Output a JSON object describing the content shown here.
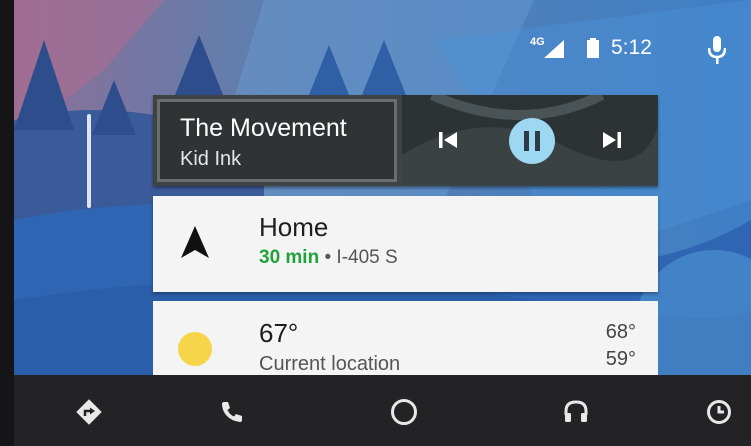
{
  "status": {
    "network": "4G",
    "time": "5:12"
  },
  "icons": {
    "signal": "signal-icon",
    "battery": "battery-icon",
    "mic": "mic-icon",
    "previous": "skip-previous-icon",
    "pause": "pause-icon",
    "next": "skip-next-icon",
    "navigation": "navigation-arrow-icon",
    "weather": "sun-icon",
    "nav_directions": "directions-icon",
    "phone": "phone-icon",
    "home": "home-circle-icon",
    "audio": "headphones-icon",
    "exit": "exit-icon"
  },
  "media": {
    "title": "The Movement",
    "artist": "Kid Ink"
  },
  "navigation": {
    "destination": "Home",
    "eta": "30 min",
    "route": " • I-405 S"
  },
  "weather": {
    "temperature": "67°",
    "location": "Current location",
    "high": "68°",
    "low": "59°"
  },
  "colors": {
    "accent_play": "#9ed7f2",
    "eta_green": "#22a23a",
    "sun": "#f6d54a"
  }
}
